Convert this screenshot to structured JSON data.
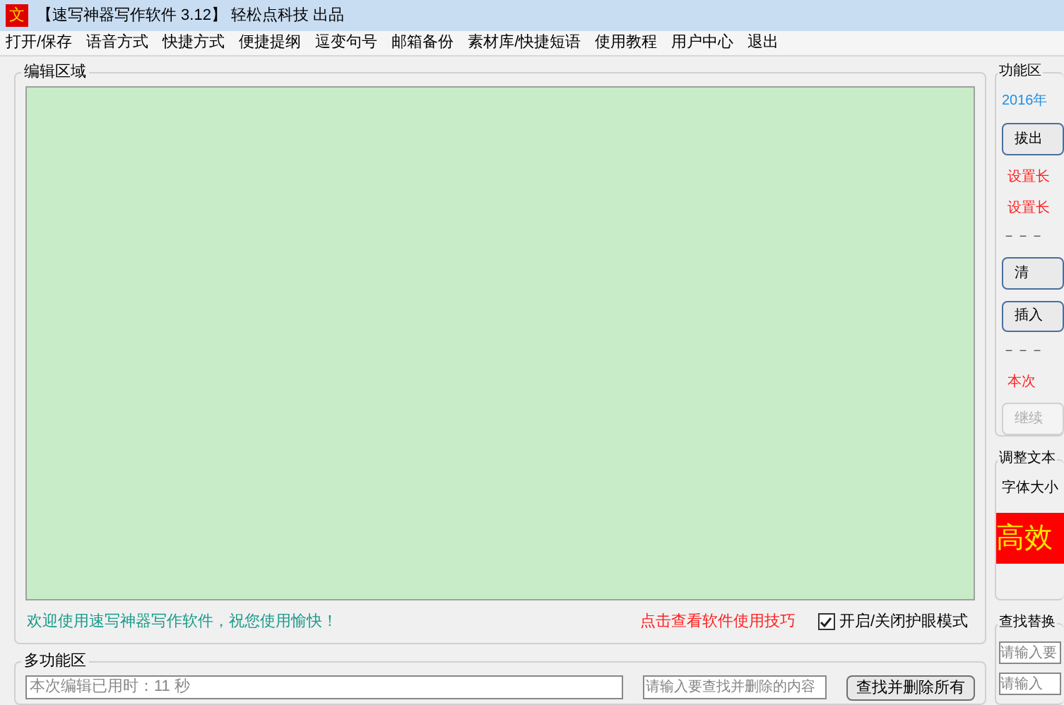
{
  "window": {
    "title": "【速写神器写作软件 3.12】 轻松点科技 出品",
    "app_icon": "文"
  },
  "menu": [
    "打开/保存",
    "语音方式",
    "快捷方式",
    "便捷提纲",
    "逗变句号",
    "邮箱备份",
    "素材库/快捷短语",
    "使用教程",
    "用户中心",
    "退出"
  ],
  "editor": {
    "title": "编辑区域",
    "welcome": "欢迎使用速写神器写作软件，祝您使用愉快！",
    "tips_link": "点击查看软件使用技巧",
    "eye_mode": {
      "label": "开启/关闭护眼模式",
      "checked": true
    }
  },
  "multi": {
    "title": "多功能区",
    "timer": "本次编辑已用时：11 秒",
    "search_placeholder": "请输入要查找并删除的内容",
    "delete_button": "查找并删除所有"
  },
  "side": {
    "title": "功能区",
    "date": "2016年",
    "items": [
      {
        "kind": "button",
        "text": "拔出",
        "disabled": false
      },
      {
        "kind": "label",
        "text": "设置长"
      },
      {
        "kind": "label",
        "text": "设置长"
      },
      {
        "kind": "dash",
        "text": "－－－"
      },
      {
        "kind": "button",
        "text": "清",
        "disabled": false
      },
      {
        "kind": "button",
        "text": "插入",
        "disabled": false
      },
      {
        "kind": "dash",
        "text": "－－－"
      },
      {
        "kind": "label",
        "text": "本次"
      },
      {
        "kind": "button",
        "text": "继续",
        "disabled": true
      }
    ]
  },
  "adjust": {
    "title": "调整文本",
    "font_size": "字体大小",
    "sample": "高效"
  },
  "find": {
    "title": "查找替换",
    "fields": [
      {
        "placeholder": "请输入要"
      },
      {
        "placeholder": "请输入"
      }
    ]
  }
}
